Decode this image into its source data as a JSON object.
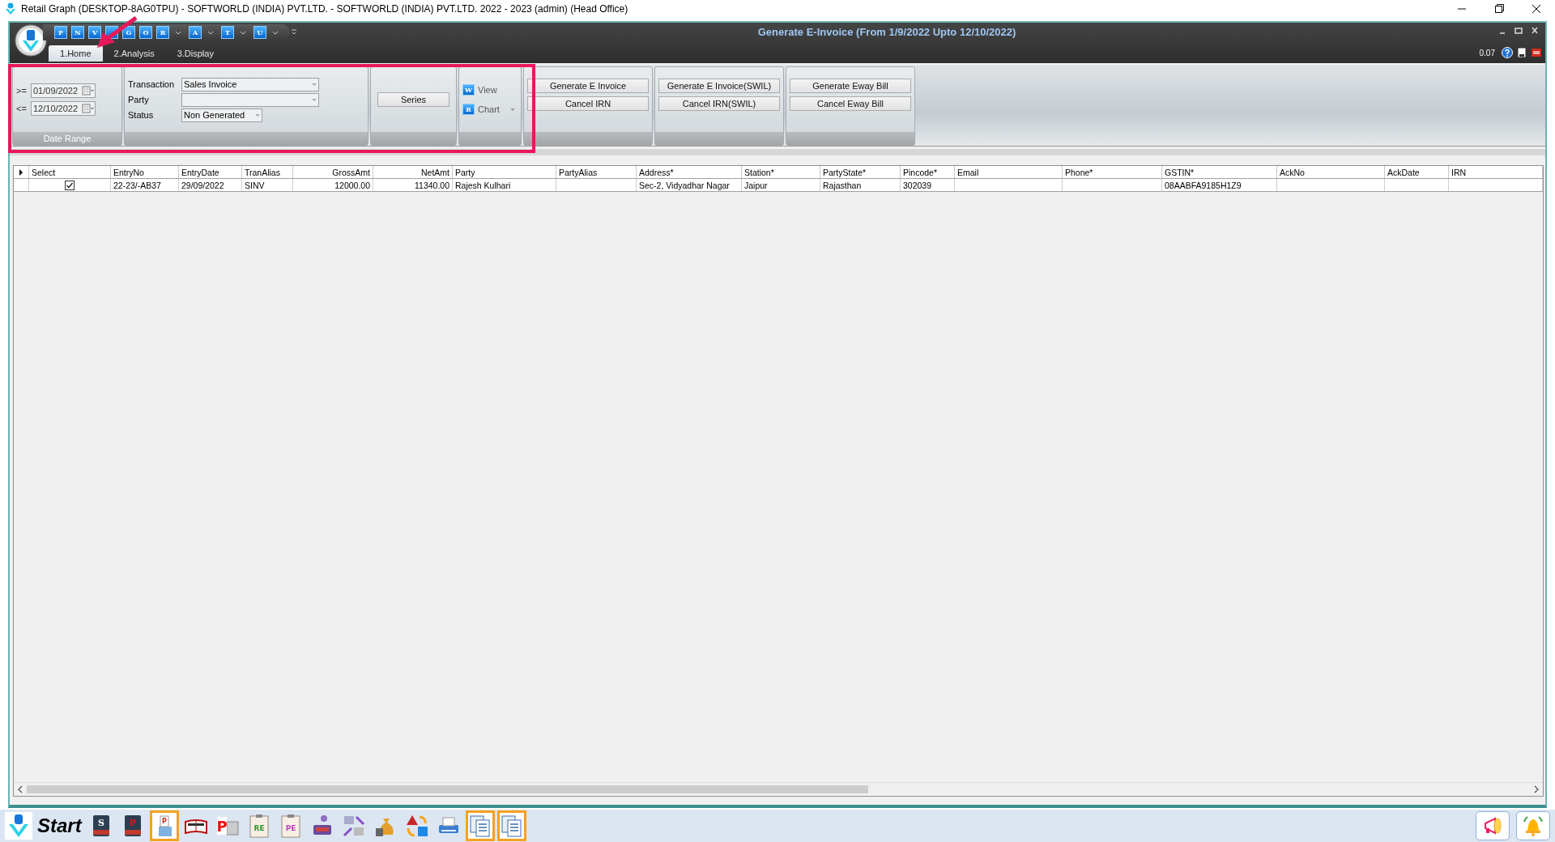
{
  "window": {
    "title": "Retail Graph (DESKTOP-8AG0TPU) - SOFTWORLD (INDIA) PVT.LTD. - SOFTWORLD (INDIA) PVT.LTD.  2022 - 2023 (admin) (Head Office)"
  },
  "app": {
    "caption": "Generate E-Invoice (From 1/9/2022 Upto 12/10/2022)",
    "status_value": "0.07",
    "quick_access": [
      {
        "letter": "P",
        "dropdown": false
      },
      {
        "letter": "N",
        "dropdown": false
      },
      {
        "letter": "V",
        "dropdown": false
      },
      {
        "dropdown": false
      },
      {
        "letter": "G",
        "dropdown": false
      },
      {
        "letter": "O",
        "dropdown": false
      },
      {
        "letter": "R",
        "dropdown": true
      },
      {
        "letter": "A",
        "dropdown": true
      },
      {
        "letter": "T",
        "dropdown": true
      },
      {
        "letter": "U",
        "dropdown": true
      }
    ],
    "tabs": [
      {
        "label": "1.Home",
        "selected": true
      },
      {
        "label": "2.Analysis",
        "selected": false
      },
      {
        "label": "3.Display",
        "selected": false
      }
    ]
  },
  "ribbon": {
    "date_range": {
      "label": "Date Range",
      "rows": [
        {
          "operator": ">=",
          "value": "01/09/2022"
        },
        {
          "operator": "<=",
          "value": "12/10/2022"
        }
      ]
    },
    "filters": [
      {
        "label": "Transaction",
        "value": "Sales Invoice"
      },
      {
        "label": "Party"
      },
      {
        "label": "Status",
        "value": "Non Generated"
      }
    ],
    "series_button": "Series",
    "view_items": [
      {
        "label": "View",
        "letter": "W",
        "dropdown": false
      },
      {
        "label": "Chart",
        "letter": "R",
        "dropdown": true
      }
    ],
    "button_groups": [
      [
        "Generate E Invoice",
        "Cancel IRN"
      ],
      [
        "Generate E Invoice(SWIL)",
        "Cancel IRN(SWIL)"
      ],
      [
        "Generate Eway Bill",
        "Cancel Eway Bill"
      ]
    ]
  },
  "table": {
    "columns": [
      {
        "label": "Select",
        "kind": "check"
      },
      {
        "label": "EntryNo",
        "kind": "text"
      },
      {
        "label": "EntryDate",
        "kind": "text"
      },
      {
        "label": "TranAlias",
        "kind": "text"
      },
      {
        "label": "GrossAmt",
        "kind": "amount"
      },
      {
        "label": "NetAmt",
        "kind": "amount"
      },
      {
        "label": "Party",
        "kind": "text"
      },
      {
        "label": "PartyAlias",
        "kind": "text"
      },
      {
        "label": "Address*",
        "kind": "text"
      },
      {
        "label": "Station*",
        "kind": "text"
      },
      {
        "label": "PartyState*",
        "kind": "text"
      },
      {
        "label": "Pincode*",
        "kind": "text"
      },
      {
        "label": "Email",
        "kind": "text"
      },
      {
        "label": "Phone*",
        "kind": "text"
      },
      {
        "label": "GSTIN*",
        "kind": "text"
      },
      {
        "label": "AckNo",
        "kind": "text"
      },
      {
        "label": "AckDate",
        "kind": "text"
      },
      {
        "label": "IRN",
        "kind": "text"
      }
    ],
    "rows": [
      {
        "checked": true,
        "cells": {
          "1": "22-23/-AB37",
          "2": "29/09/2022",
          "3": "SINV",
          "4": "12000.00",
          "5": "11340.00",
          "6": "Rajesh Kulhari",
          "8": "Sec-2, Vidyadhar Nagar",
          "9": "Jaipur",
          "10": "Rajasthan",
          "11": "302039",
          "14": "08AABFA9185H1Z9"
        }
      }
    ]
  },
  "taskbar": {
    "start_label": "Start",
    "items": [
      {
        "kind": "voucher",
        "letter": "S",
        "selected": false
      },
      {
        "kind": "voucher",
        "letter": "P",
        "selected": false
      },
      {
        "kind": "printer",
        "letter": "P",
        "selected": true
      },
      {
        "kind": "book",
        "selected": false
      },
      {
        "kind": "press",
        "letter": "P",
        "selected": false
      },
      {
        "kind": "clipboard",
        "letter": "RE",
        "selected": false
      },
      {
        "kind": "clipboard",
        "letter": "PE",
        "selected": false
      },
      {
        "kind": "cashier",
        "selected": false
      },
      {
        "kind": "exchange",
        "selected": false
      },
      {
        "kind": "moneybag",
        "selected": false
      },
      {
        "kind": "shapes",
        "selected": false
      },
      {
        "kind": "scanner",
        "selected": false
      },
      {
        "kind": "document",
        "selected": true
      },
      {
        "kind": "document",
        "selected": true
      }
    ],
    "tray": [
      {
        "kind": "megaphone"
      },
      {
        "kind": "bell"
      }
    ]
  }
}
